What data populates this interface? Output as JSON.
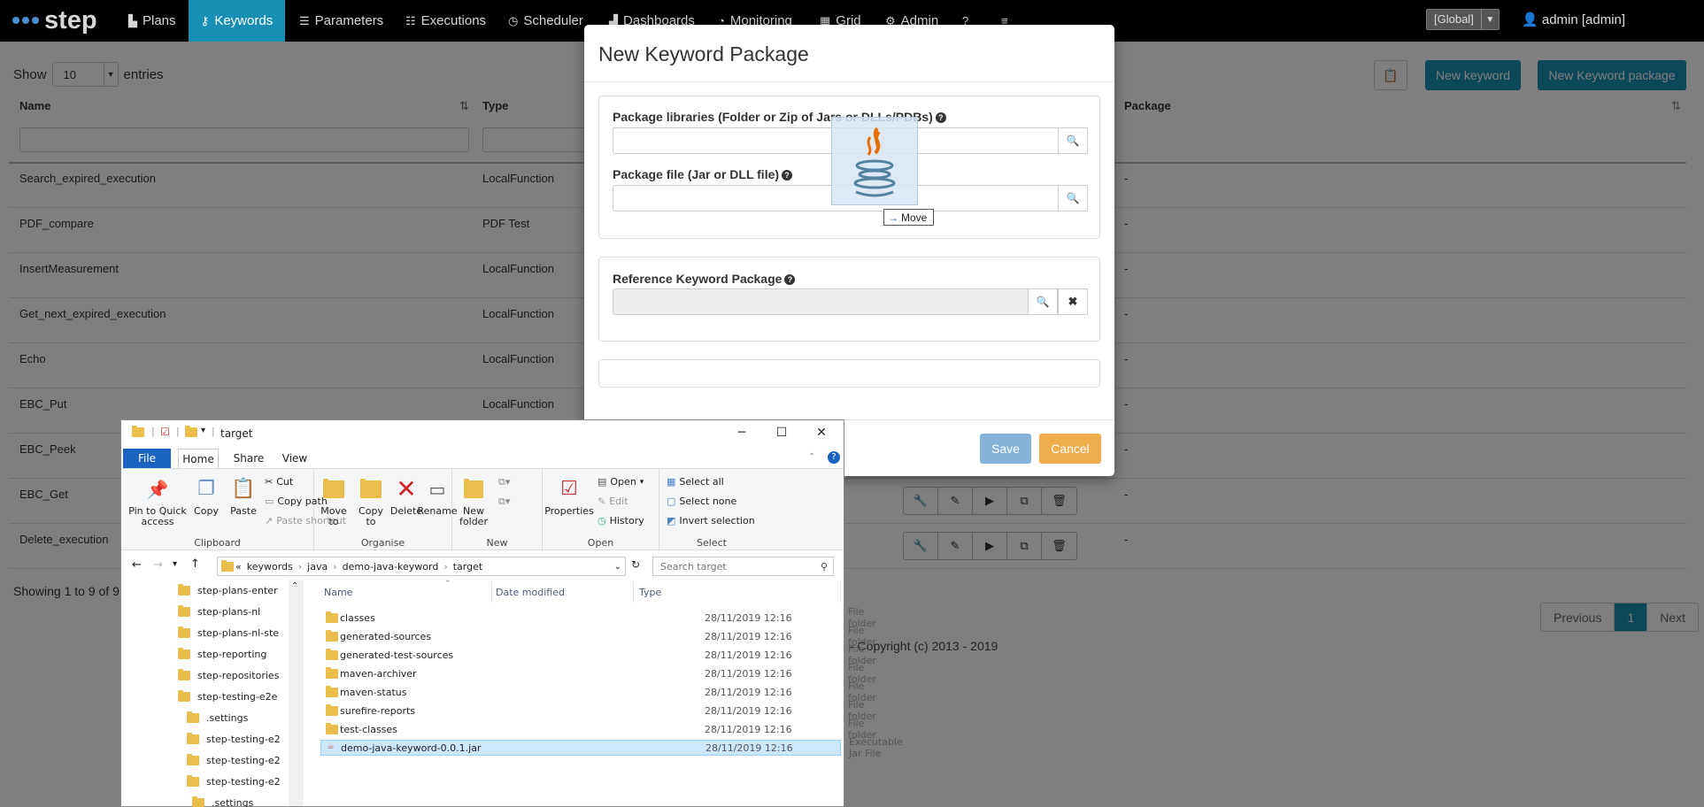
{
  "navbar": {
    "brand": "step",
    "items": [
      {
        "label": "Plans",
        "icon": "file-icon"
      },
      {
        "label": "Keywords",
        "icon": "key-icon",
        "active": true
      },
      {
        "label": "Parameters",
        "icon": "list-icon"
      },
      {
        "label": "Executions",
        "icon": "tasks-icon"
      },
      {
        "label": "Scheduler",
        "icon": "clock-icon"
      },
      {
        "label": "Dashboards",
        "icon": "bar-chart-icon"
      },
      {
        "label": "Monitoring",
        "icon": "dashboard-icon"
      },
      {
        "label": "Grid",
        "icon": "grid-icon"
      },
      {
        "label": "Admin",
        "icon": "gear-icon"
      }
    ],
    "help_icon": "question-icon",
    "menu_icon": "hamburger-icon",
    "scope": "[Global]",
    "user": "admin [admin]",
    "accent": "#1a8fb5"
  },
  "page": {
    "show_label": "Show",
    "entries_value": "10",
    "entries_label": "entries",
    "columns": [
      "Name",
      "Type",
      "Package"
    ],
    "buttons": {
      "new_keyword": "New keyword",
      "new_package": "New Keyword package"
    },
    "rows": [
      {
        "name": "Search_expired_execution",
        "type": "LocalFunction",
        "package": "-"
      },
      {
        "name": "PDF_compare",
        "type": "PDF Test",
        "package": "-"
      },
      {
        "name": "InsertMeasurement",
        "type": "LocalFunction",
        "package": "-"
      },
      {
        "name": "Get_next_expired_execution",
        "type": "LocalFunction",
        "package": "-"
      },
      {
        "name": "Echo",
        "type": "LocalFunction",
        "package": "-"
      },
      {
        "name": "EBC_Put",
        "type": "LocalFunction",
        "package": "-"
      },
      {
        "name": "EBC_Peek",
        "type": "",
        "package": "-"
      },
      {
        "name": "EBC_Get",
        "type": "",
        "package": "-"
      },
      {
        "name": "Delete_execution",
        "type": "",
        "package": "-"
      }
    ],
    "showing": "Showing 1 to 9 of 9",
    "pager": {
      "previous": "Previous",
      "current": "1",
      "next": "Next"
    },
    "copyright": "- Copyright (c) 2013 - 2019"
  },
  "modal": {
    "title": "New Keyword Package",
    "libraries_label": "Package libraries (Folder or Zip of Jars or DLLs/PDBs)",
    "package_file_label": "Package file (Jar or DLL file)",
    "reference_label": "Reference Keyword Package",
    "save": "Save",
    "cancel": "Cancel",
    "drag_tip": "Move"
  },
  "explorer": {
    "title": "target",
    "tabs": [
      "File",
      "Home",
      "Share",
      "View"
    ],
    "ribbon": {
      "clipboard": {
        "label": "Clipboard",
        "pin": "Pin to Quick access",
        "copy": "Copy",
        "paste": "Paste",
        "cut": "Cut",
        "copy_path": "Copy path",
        "paste_shortcut": "Paste shortcut"
      },
      "organise": {
        "label": "Organise",
        "move_to": "Move to",
        "copy_to": "Copy to",
        "delete": "Delete",
        "rename": "Rename"
      },
      "new": {
        "label": "New",
        "new_folder": "New folder"
      },
      "open": {
        "label": "Open",
        "properties": "Properties",
        "open": "Open",
        "edit": "Edit",
        "history": "History"
      },
      "select": {
        "label": "Select",
        "select_all": "Select all",
        "select_none": "Select none",
        "invert": "Invert selection"
      }
    },
    "breadcrumb": [
      "«",
      "keywords",
      "java",
      "demo-java-keyword",
      "target"
    ],
    "search_placeholder": "Search target",
    "nav_items": [
      "step-plans-enter",
      "step-plans-nl",
      "step-plans-nl-ste",
      "step-reporting",
      "step-repositories",
      "step-testing-e2e",
      ".settings",
      "step-testing-e2",
      "step-testing-e2",
      "step-testing-e2",
      ".settings"
    ],
    "columns": [
      "Name",
      "Date modified",
      "Type"
    ],
    "files": [
      {
        "name": "classes",
        "date": "28/11/2019 12:16",
        "type": "File folder"
      },
      {
        "name": "generated-sources",
        "date": "28/11/2019 12:16",
        "type": "File folder"
      },
      {
        "name": "generated-test-sources",
        "date": "28/11/2019 12:16",
        "type": "File folder"
      },
      {
        "name": "maven-archiver",
        "date": "28/11/2019 12:16",
        "type": "File folder"
      },
      {
        "name": "maven-status",
        "date": "28/11/2019 12:16",
        "type": "File folder"
      },
      {
        "name": "surefire-reports",
        "date": "28/11/2019 12:16",
        "type": "File folder"
      },
      {
        "name": "test-classes",
        "date": "28/11/2019 12:16",
        "type": "File folder"
      },
      {
        "name": "demo-java-keyword-0.0.1.jar",
        "date": "28/11/2019 12:16",
        "type": "Executable Jar File",
        "selected": true
      }
    ]
  }
}
